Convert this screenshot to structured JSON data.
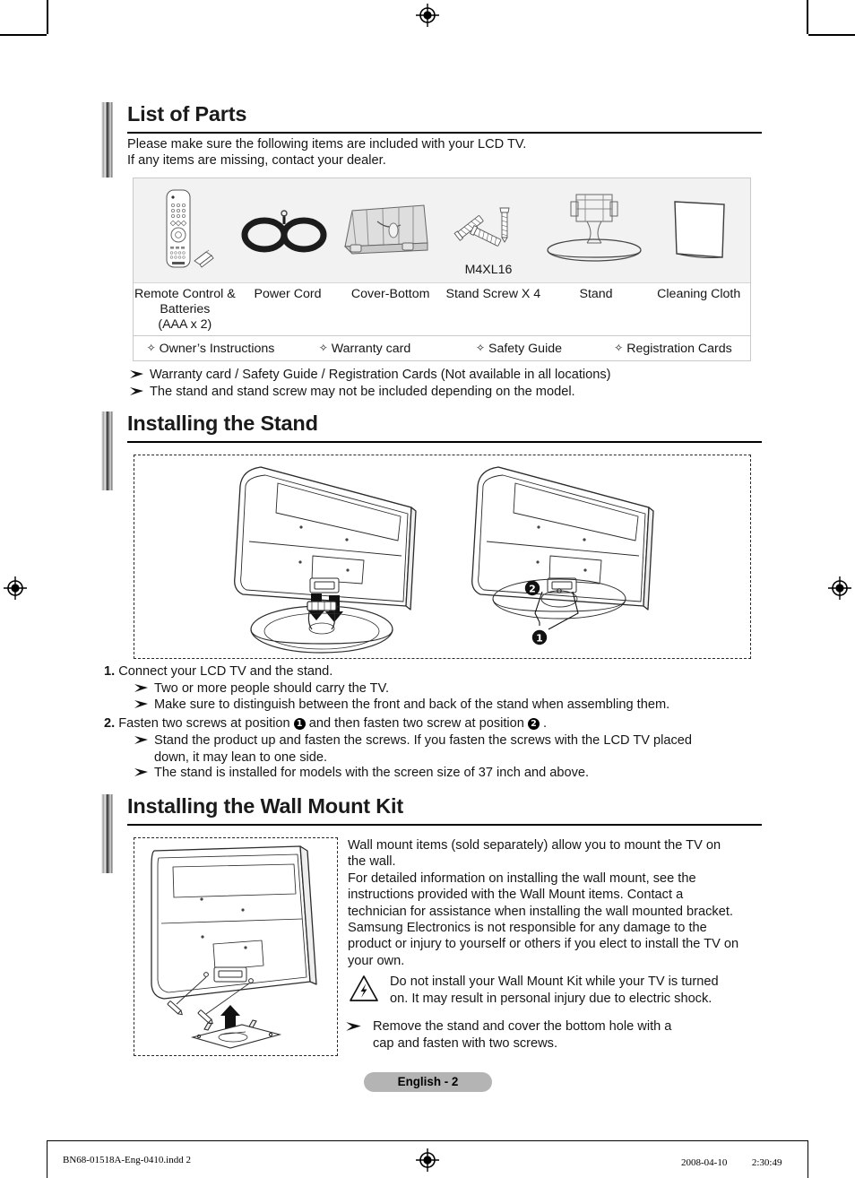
{
  "sections": {
    "parts": {
      "title": "List of Parts",
      "intro": "Please make sure the following items are included with your LCD TV.\nIf any items are missing, contact your dealer.",
      "items": [
        {
          "icon": "remote-control-icon",
          "label": "Remote Control &\nBatteries\n(AAA x 2)",
          "code": ""
        },
        {
          "icon": "power-cord-icon",
          "label": "Power Cord",
          "code": ""
        },
        {
          "icon": "cover-bottom-icon",
          "label": "Cover-Bottom",
          "code": ""
        },
        {
          "icon": "stand-screw-icon",
          "label": "Stand Screw X 4",
          "code": "M4XL16"
        },
        {
          "icon": "stand-icon",
          "label": "Stand",
          "code": ""
        },
        {
          "icon": "cleaning-cloth-icon",
          "label": "Cleaning Cloth",
          "code": ""
        }
      ],
      "documents": [
        "Owner’s Instructions",
        "Warranty card",
        "Safety Guide",
        "Registration Cards"
      ],
      "notes": [
        "Warranty card / Safety Guide / Registration Cards (Not available in all locations)",
        "The stand and stand screw may not be included depending on the model."
      ]
    },
    "stand": {
      "title": "Installing the Stand",
      "figure_caption": "",
      "steps": [
        {
          "number": "1.",
          "text": "Connect your LCD TV and the stand.",
          "notes": [
            "Two or more people should carry the TV.",
            "Make sure to distinguish between the front and back of the stand when assembling them."
          ]
        },
        {
          "number": "2.",
          "text_before": "Fasten two screws at position ",
          "marker_one": "1",
          "text_middle": " and then fasten two screw at position ",
          "marker_two": "2",
          "text_after": ".",
          "notes": [
            "Stand the product up and fasten the screws. If you fasten the screws with the LCD TV placed\ndown, it may lean to one side.",
            "The stand is installed for models with the screen size of 37 inch and above."
          ]
        }
      ],
      "diagram_markers": {
        "one": "1",
        "two": "2"
      }
    },
    "wallmount": {
      "title": "Installing the Wall Mount Kit",
      "body": "Wall mount items (sold separately) allow you to mount the TV on\nthe wall.\nFor detailed information on installing the wall mount, see the\ninstructions provided with the Wall Mount items. Contact a\ntechnician for assistance when installing the wall mounted bracket.\nSamsung Electronics is not responsible for any damage to the\nproduct or injury to yourself or others if you elect to install the TV on\nyour own.",
      "warning": "Do not install your Wall Mount Kit while your TV is turned\non. It may result in personal injury due to electric shock.",
      "note": "Remove the stand and cover the bottom hole with a\ncap and fasten with two screws."
    }
  },
  "footer": {
    "page_label": "English - 2",
    "print_filename": "BN68-01518A-Eng-0410.indd   2",
    "print_timestamp": "2008-04-10   　　 2:30:49"
  },
  "colors": {
    "panel_background": "#f2f2f2",
    "pill_background": "#b4b4b4",
    "rule": "#000000",
    "text": "#161616"
  }
}
